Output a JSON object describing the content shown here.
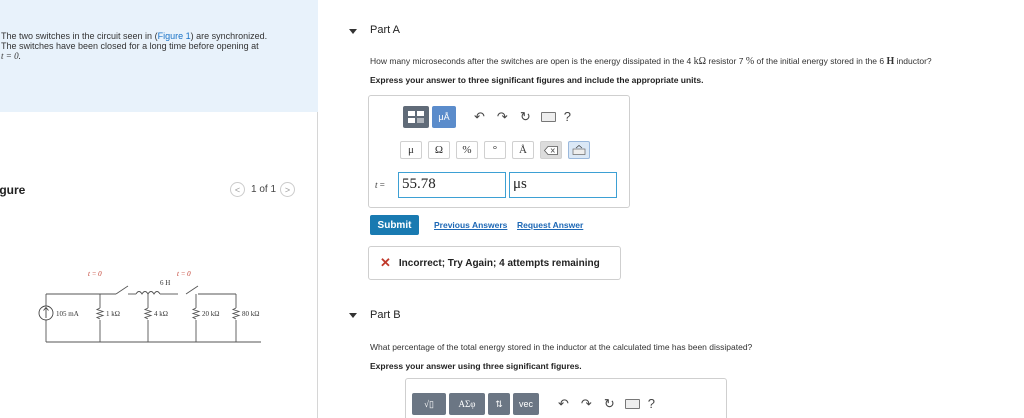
{
  "intro": {
    "line1_a": "The two switches in the circuit seen in (",
    "figure_link": "Figure 1",
    "line1_b": ") are synchronized.",
    "line2": "The switches have been closed for a long time before opening at",
    "line3": "t = 0."
  },
  "figure": {
    "header": "igure",
    "pager_text": "1 of 1",
    "prev": "<",
    "next": ">"
  },
  "circuit": {
    "switch1_label": "t = 0",
    "switch2_label": "t = 0",
    "inductor_label": "6 H",
    "source_label": "105 mA",
    "r1_label": "1 kΩ",
    "r2_label": "4 kΩ",
    "r3_label": "20 kΩ",
    "r4_label": "80 kΩ"
  },
  "part_a": {
    "title": "Part A",
    "question_a": "How many microseconds after the switches are open is the energy dissipated in the 4",
    "q_res": "kΩ",
    "question_b": "resistor 7",
    "q_pct": "%",
    "question_c": "of the initial energy stored in the 6",
    "q_h": "H",
    "question_d": "inductor?",
    "instruction": "Express your answer to three significant figures and include the appropriate units.",
    "toolbar": {
      "units_button": "μÅ",
      "undo": "↶",
      "redo": "↷",
      "reset": "↻",
      "help": "?",
      "symbols": [
        "μ",
        "Ω",
        "%",
        "°",
        "Å"
      ]
    },
    "variable": "t",
    "equals": "=",
    "value": "55.78",
    "unit": "μs",
    "submit": "Submit",
    "previous_answers": "Previous Answers",
    "request_answer": "Request Answer",
    "feedback_icon": "✕",
    "feedback": "Incorrect; Try Again; 4 attempts remaining"
  },
  "part_b": {
    "title": "Part B",
    "question": "What percentage of the total energy stored in the inductor at the calculated time has been dissipated?",
    "instruction": "Express your answer using three significant figures.",
    "toolbar": {
      "templates": "√▯",
      "greek": "ΑΣφ",
      "arrows": "⇅",
      "vec": "vec",
      "undo": "↶",
      "redo": "↷",
      "reset": "↻",
      "help": "?"
    }
  },
  "colors": {
    "intro_bg": "#e8f2fb",
    "submit_bg": "#197ab1",
    "link": "#1c67b5",
    "error": "#c0392b",
    "field_border": "#3da0d4"
  }
}
